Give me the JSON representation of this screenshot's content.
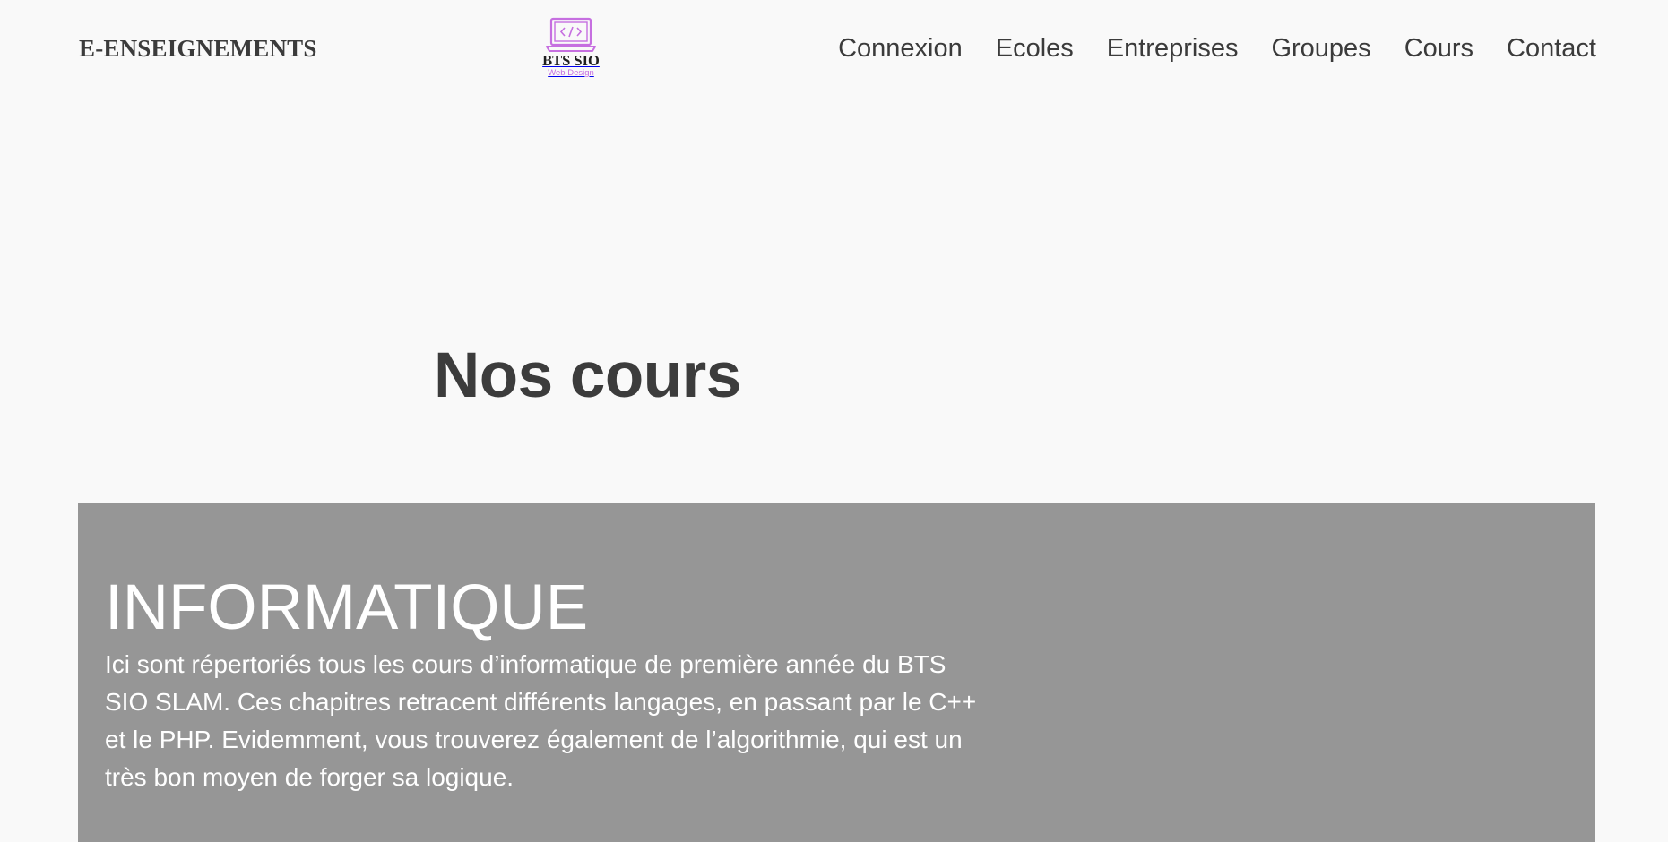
{
  "header": {
    "site_title": "E-ENSEIGNEMENTS",
    "logo": {
      "icon": "laptop-code-icon",
      "main_text": "BTS SIO",
      "sub_text": "Web Design",
      "accent_color": "#c66fe0"
    },
    "nav": [
      {
        "label": "Connexion"
      },
      {
        "label": "Ecoles"
      },
      {
        "label": "Entreprises"
      },
      {
        "label": "Groupes"
      },
      {
        "label": "Cours"
      },
      {
        "label": "Contact"
      }
    ]
  },
  "main": {
    "heading": "Nos cours",
    "course": {
      "title": "INFORMATIQUE",
      "description": "Ici sont répertoriés tous les cours d’informatique de première année du BTS SIO SLAM. Ces chapitres retracent différents langages, en passant par le C++ et le PHP. Evidemment, vous trouverez également de l’algorithmie, qui est un très bon moyen de forger sa logique.",
      "background_color": "#969696"
    }
  },
  "colors": {
    "page_background": "#f9f9f9",
    "text": "#3b3b3b"
  }
}
